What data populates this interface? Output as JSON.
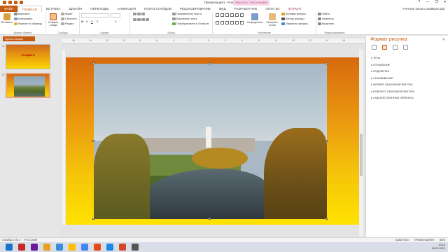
{
  "window": {
    "title": "Презентация1 - PowerPoint",
    "context_tab": "РАБОТА С РИСУНКАМИ",
    "controls": [
      "?",
      "—",
      "❐",
      "✕"
    ]
  },
  "tabs": [
    {
      "label": "ФАЙЛ"
    },
    {
      "label": "ГЛАВНАЯ"
    },
    {
      "label": "ВСТАВКА"
    },
    {
      "label": "ДИЗАЙН"
    },
    {
      "label": "ПЕРЕХОДЫ"
    },
    {
      "label": "АНИМАЦИЯ"
    },
    {
      "label": "ПОКАЗ СЛАЙДОВ"
    },
    {
      "label": "РЕЦЕНЗИРОВАНИЕ"
    },
    {
      "label": "ВИД"
    },
    {
      "label": "РАЗРАБОТЧИК"
    },
    {
      "label": "ОПЯТ ВА"
    },
    {
      "label": "ФОРМАТ"
    }
  ],
  "user": "Учетная запись Майкрософт",
  "ribbon": {
    "clipboard": {
      "paste": "Вставить",
      "cut": "Вырезать",
      "copy": "Копировать",
      "format_painter": "Формат по образцу",
      "label": "Буфер обмена"
    },
    "slides": {
      "new_slide": "Создать слайд",
      "layout": "Макет",
      "reset": "Сбросить",
      "section": "Раздел",
      "label": "Слайды"
    },
    "font": {
      "label": "Шрифт"
    },
    "paragraph": {
      "text_direction": "Направление текста",
      "align_text": "Выровнять текст",
      "smartart": "Преобразовать в SmartArt",
      "label": "Абзац"
    },
    "drawing": {
      "arrange": "Упорядочить",
      "quick_styles": "Экспресс-стили",
      "fill": "Заливка фигуры",
      "outline": "Контур фигуры",
      "effects": "Эффекты фигуры",
      "label": "Рисование"
    },
    "editing": {
      "find": "Найти",
      "replace": "Заменить",
      "select": "Выделить",
      "label": "Редактирование"
    }
  },
  "thumbnails": {
    "doc_tab": "Презентация1",
    "slides": [
      {
        "number": "1",
        "title": "СОЗДАТЬ"
      },
      {
        "number": "2"
      }
    ]
  },
  "ruler": [
    "16",
    "14",
    "12",
    "10",
    "8",
    "6",
    "4",
    "2",
    "0",
    "2",
    "4",
    "6",
    "8",
    "10",
    "12",
    "14",
    "16"
  ],
  "format_pane": {
    "title": "Формат рисунка",
    "items": [
      "ТЕНЬ",
      "ОТРАЖЕНИЕ",
      "ПОДСВЕТКА",
      "СГЛАЖИВАНИЕ",
      "ФОРМАТ ОБЪЕМНОЙ ФИГУРЫ",
      "ПОВОРОТ ОБЪЕМНОЙ ФИГУРЫ",
      "ХУДОЖЕСТВЕННЫЕ ЭФФЕКТЫ"
    ]
  },
  "status": {
    "slide": "СЛАЙД 2 ИЗ 2",
    "lang": "РУССКИЙ",
    "notes": "ЗАМЕТКИ",
    "comments": "ПРИМЕЧАНИЯ",
    "zoom": "86%"
  },
  "taskbar": {
    "time": "10:15",
    "date": "04.02.2021"
  },
  "colors": {
    "accent": "#c55a11",
    "context": "#b2457b"
  }
}
